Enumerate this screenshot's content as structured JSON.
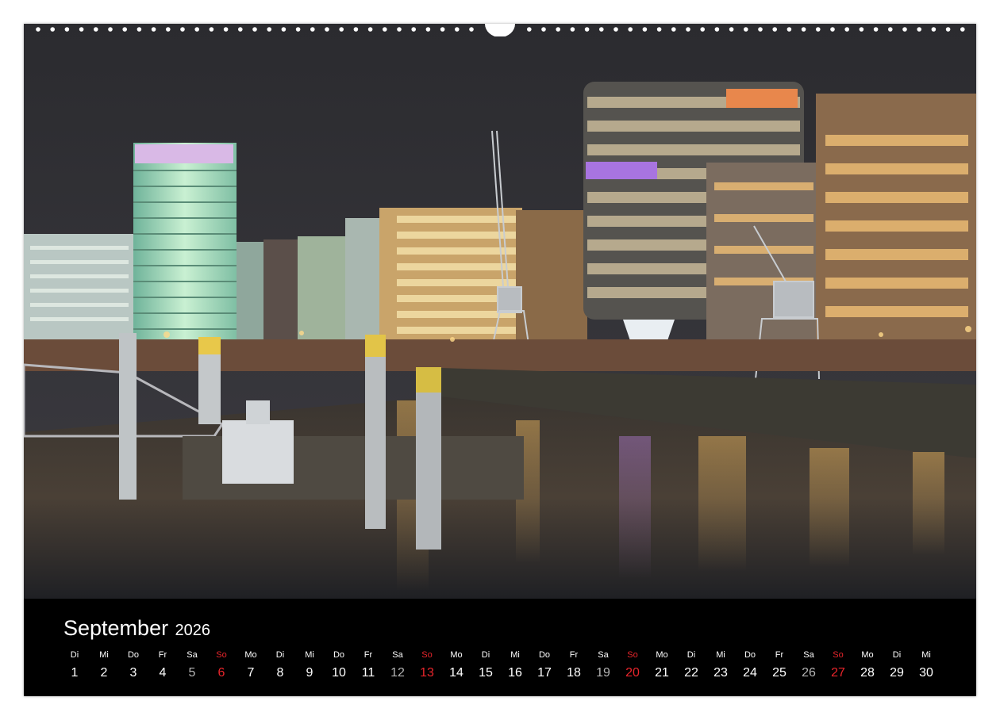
{
  "calendar": {
    "month": "September",
    "year": "2026",
    "days": [
      {
        "wd": "Di",
        "d": "1"
      },
      {
        "wd": "Mi",
        "d": "2"
      },
      {
        "wd": "Do",
        "d": "3"
      },
      {
        "wd": "Fr",
        "d": "4"
      },
      {
        "wd": "Sa",
        "d": "5"
      },
      {
        "wd": "So",
        "d": "6"
      },
      {
        "wd": "Mo",
        "d": "7"
      },
      {
        "wd": "Di",
        "d": "8"
      },
      {
        "wd": "Mi",
        "d": "9"
      },
      {
        "wd": "Do",
        "d": "10"
      },
      {
        "wd": "Fr",
        "d": "11"
      },
      {
        "wd": "Sa",
        "d": "12"
      },
      {
        "wd": "So",
        "d": "13"
      },
      {
        "wd": "Mo",
        "d": "14"
      },
      {
        "wd": "Di",
        "d": "15"
      },
      {
        "wd": "Mi",
        "d": "16"
      },
      {
        "wd": "Do",
        "d": "17"
      },
      {
        "wd": "Fr",
        "d": "18"
      },
      {
        "wd": "Sa",
        "d": "19"
      },
      {
        "wd": "So",
        "d": "20"
      },
      {
        "wd": "Mo",
        "d": "21"
      },
      {
        "wd": "Di",
        "d": "22"
      },
      {
        "wd": "Mi",
        "d": "23"
      },
      {
        "wd": "Do",
        "d": "24"
      },
      {
        "wd": "Fr",
        "d": "25"
      },
      {
        "wd": "Sa",
        "d": "26"
      },
      {
        "wd": "So",
        "d": "27"
      },
      {
        "wd": "Mo",
        "d": "28"
      },
      {
        "wd": "Di",
        "d": "29"
      },
      {
        "wd": "Mi",
        "d": "30"
      }
    ]
  },
  "colors": {
    "sunday": "#e8252b",
    "saturday": "#b4b4b4",
    "weekday": "#ffffff",
    "footer_bg": "#000000"
  }
}
